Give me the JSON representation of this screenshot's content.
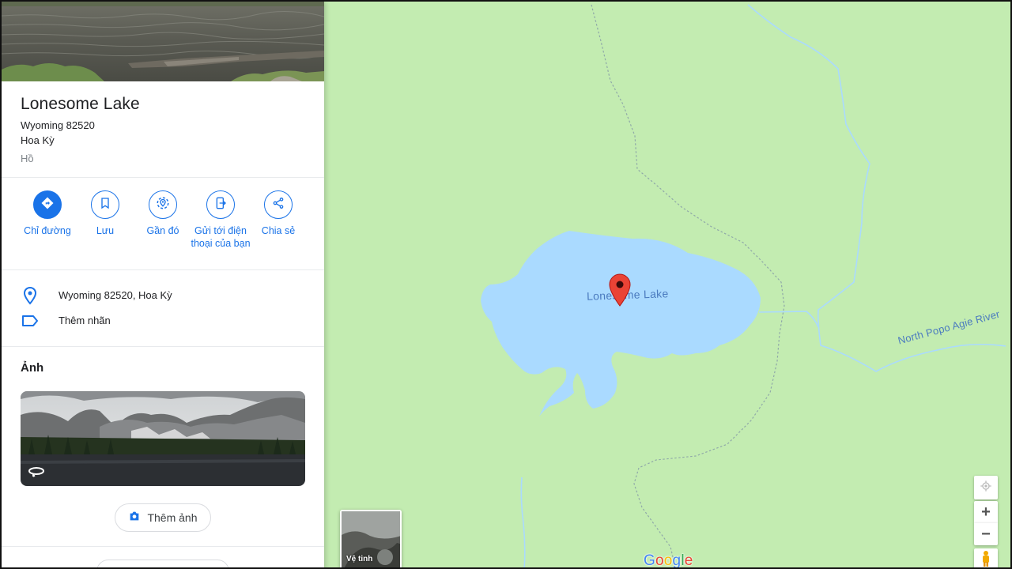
{
  "place": {
    "name": "Lonesome Lake",
    "address_line1": "Wyoming 82520",
    "address_line2": "Hoa Kỳ",
    "type": "Hồ"
  },
  "actions": [
    {
      "label": "Chỉ đường",
      "icon": "directions-icon"
    },
    {
      "label": "Lưu",
      "icon": "bookmark-icon"
    },
    {
      "label": "Gần đó",
      "icon": "nearby-icon"
    },
    {
      "label": "Gửi tới điện thoại của bạn",
      "icon": "send-to-phone-icon"
    },
    {
      "label": "Chia sẻ",
      "icon": "share-icon"
    }
  ],
  "info": {
    "address": "Wyoming 82520, Hoa Kỳ",
    "add_label": "Thêm nhãn"
  },
  "photos": {
    "heading": "Ảnh",
    "add_photo_label": "Thêm ảnh"
  },
  "map": {
    "lake_label": "Lonesome Lake",
    "river_label": "North Popo Agie River",
    "layer_label": "Vệ tinh",
    "zoom_in": "+",
    "zoom_out": "−",
    "logo": [
      "G",
      "o",
      "o",
      "g",
      "l",
      "e"
    ]
  },
  "colors": {
    "accent": "#1a73e8",
    "map_land": "#c3ecb1",
    "water": "#aadaff",
    "pin": "#ea4335"
  }
}
